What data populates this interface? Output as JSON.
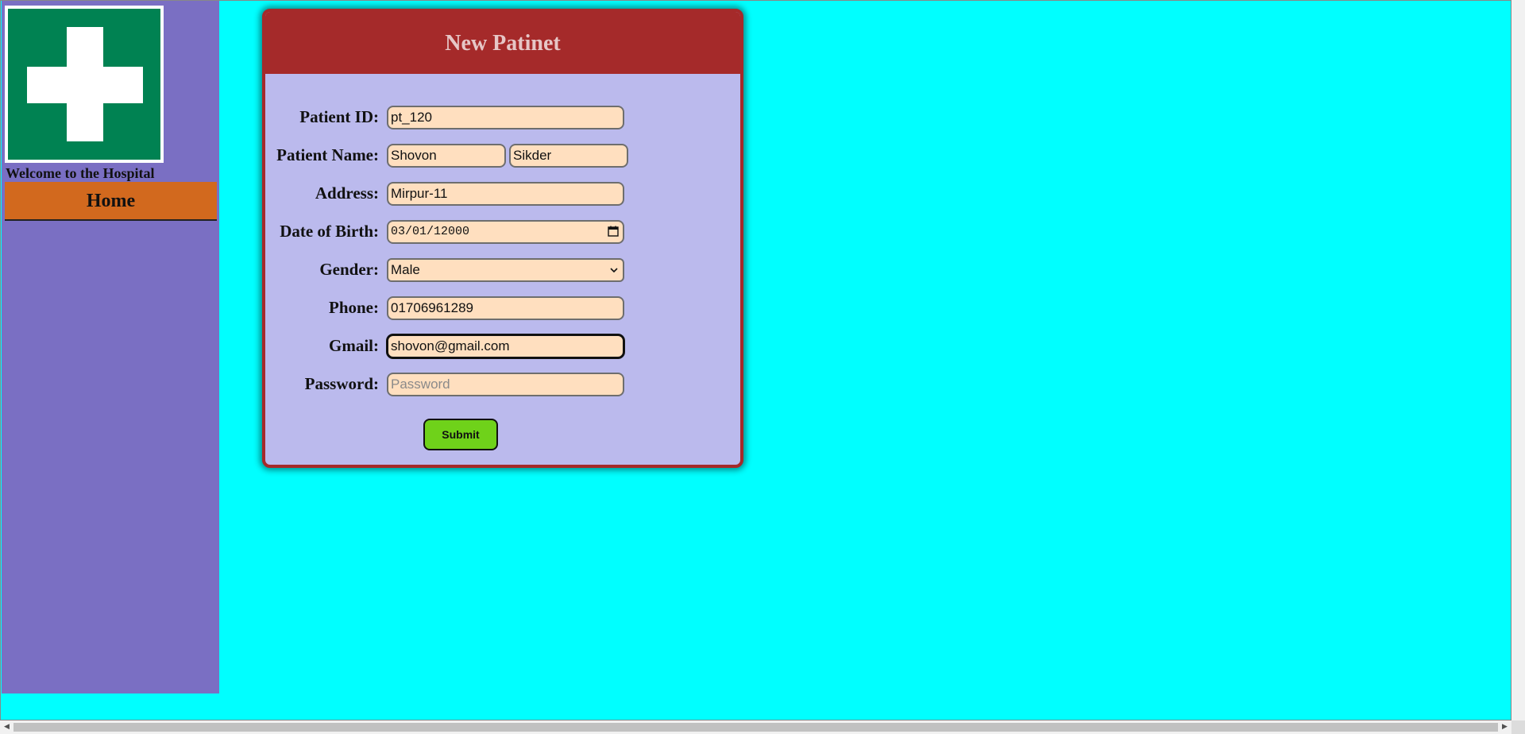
{
  "sidebar": {
    "logo_icon": "medical-cross-icon",
    "welcome_text": "Welcome to the Hospital",
    "home_label": "Home"
  },
  "form": {
    "title": "New Patinet",
    "fields": {
      "patient_id": {
        "label": "Patient ID:",
        "value": "pt_120"
      },
      "patient_name": {
        "label": "Patient Name:",
        "first_value": "Shovon",
        "last_value": "Sikder"
      },
      "address": {
        "label": "Address:",
        "value": "Mirpur-11"
      },
      "dob": {
        "label": "Date of Birth:",
        "value": "03/01/12000"
      },
      "gender": {
        "label": "Gender:",
        "value": "Male"
      },
      "phone": {
        "label": "Phone:",
        "value": "01706961289"
      },
      "gmail": {
        "label": "Gmail:",
        "value": "shovon@gmail.com"
      },
      "password": {
        "label": "Password:",
        "value": "",
        "placeholder": "Password"
      }
    },
    "submit_label": "Submit"
  },
  "colors": {
    "page_bg": "#00ffff",
    "sidebar_bg": "#7a6fc3",
    "header_bg": "#a52a2a",
    "card_bg": "#bbbaed",
    "input_bg": "#ffdfbf",
    "home_bg": "#d2691e",
    "submit_bg": "#6fd21a",
    "logo_green": "#008252"
  }
}
